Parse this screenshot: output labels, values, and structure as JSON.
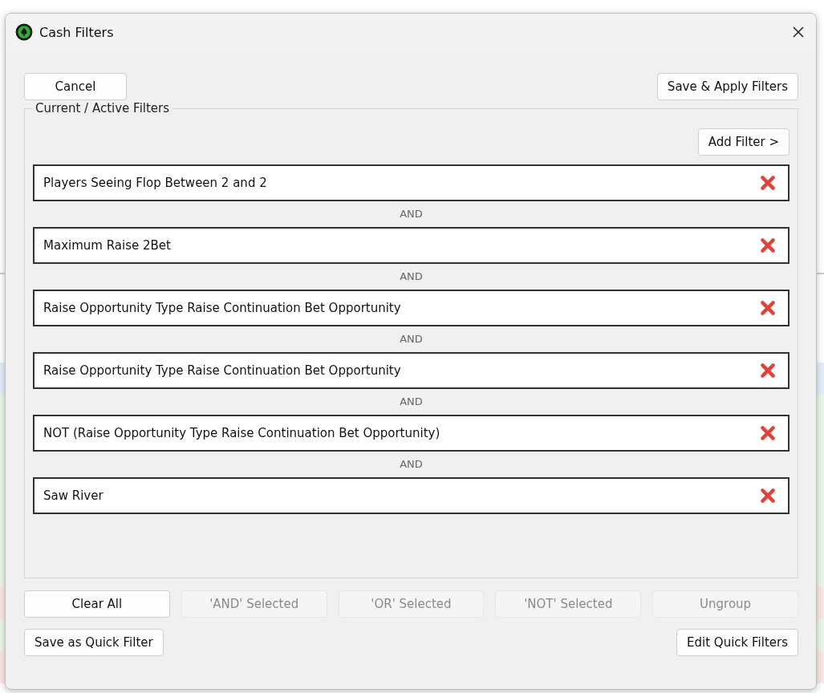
{
  "window": {
    "title": "Cash Filters"
  },
  "top_buttons": [
    {
      "label": "Cancel"
    },
    {
      "label": "Save & Apply Filters"
    }
  ],
  "group": {
    "title": "Current / Active Filters",
    "add_button": "Add Filter >",
    "filters": [
      {
        "text": "Players Seeing Flop Between 2 and 2",
        "connector": "AND"
      },
      {
        "text": "Maximum Raise 2Bet",
        "connector": "AND"
      },
      {
        "text": "Raise Opportunity Type Raise Continuation Bet Opportunity",
        "connector": "AND"
      },
      {
        "text": "Raise Opportunity Type Raise Continuation Bet Opportunity",
        "connector": "AND"
      },
      {
        "text": "NOT (Raise Opportunity Type Raise Continuation Bet Opportunity)",
        "connector": "AND"
      },
      {
        "text": "Saw River"
      }
    ]
  },
  "action_buttons": [
    {
      "label": "Clear All",
      "disabled": false
    },
    {
      "label": "'AND' Selected",
      "disabled": true
    },
    {
      "label": "'OR' Selected",
      "disabled": true
    },
    {
      "label": "'NOT' Selected",
      "disabled": true
    },
    {
      "label": "Ungroup",
      "disabled": true
    }
  ],
  "bottom_buttons": [
    {
      "label": "Save as Quick Filter"
    },
    {
      "label": "Edit Quick Filters"
    }
  ]
}
